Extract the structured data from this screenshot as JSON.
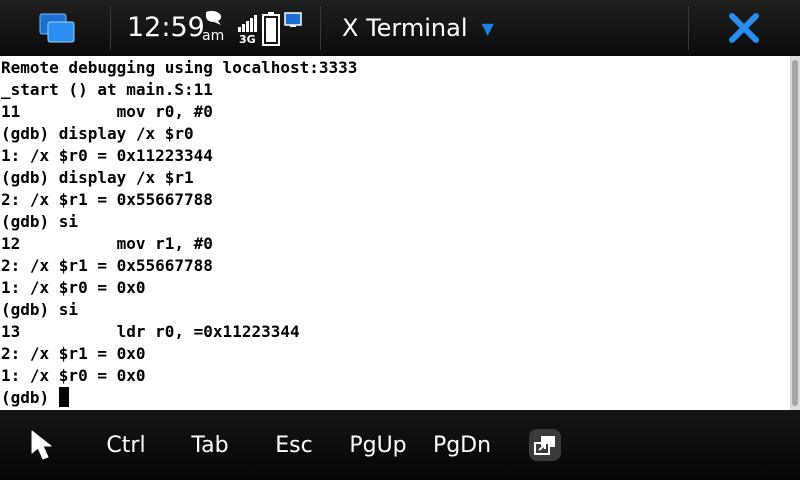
{
  "status_bar": {
    "time": "12:59",
    "ampm": "am",
    "network": "3G",
    "window_title": "X Terminal",
    "icons": {
      "switcher": "task-switcher-icon",
      "bubble": "chat-bubble-icon",
      "signal": "signal-strength-icon",
      "battery": "battery-icon",
      "display": "screen-icon",
      "close": "close-icon",
      "menu": "dropdown-caret-icon"
    },
    "accent_color": "#1e7fe0"
  },
  "terminal": {
    "lines": [
      "Remote debugging using localhost:3333",
      "_start () at main.S:11",
      "11          mov r0, #0",
      "(gdb) display /x $r0",
      "1: /x $r0 = 0x11223344",
      "(gdb) display /x $r1",
      "2: /x $r1 = 0x55667788",
      "(gdb) si",
      "12          mov r1, #0",
      "2: /x $r1 = 0x55667788",
      "1: /x $r0 = 0x0",
      "(gdb) si",
      "13          ldr r0, =0x11223344",
      "2: /x $r1 = 0x0",
      "1: /x $r0 = 0x0"
    ],
    "prompt": "(gdb) "
  },
  "toolbar": {
    "pointer_icon": "pointer-arrow-icon",
    "ctrl": "Ctrl",
    "tab": "Tab",
    "esc": "Esc",
    "pgup": "PgUp",
    "pgdn": "PgDn",
    "fullscreen_icon": "fullscreen-toggle-icon"
  }
}
